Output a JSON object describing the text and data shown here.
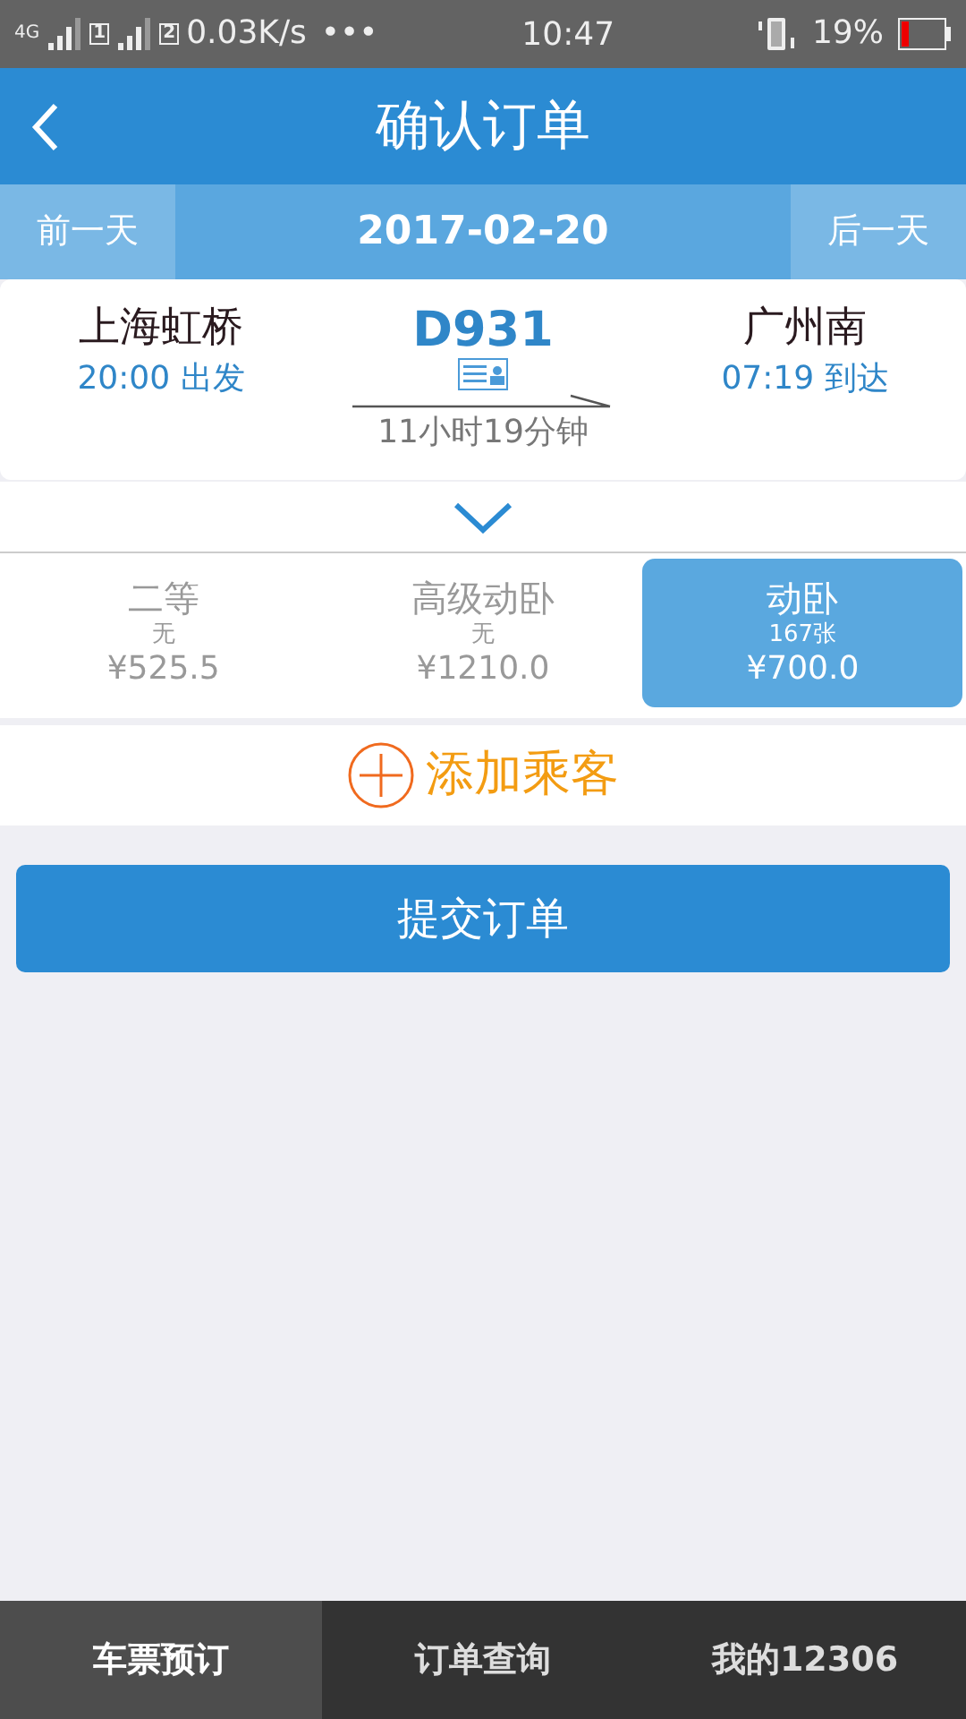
{
  "status_bar": {
    "network": "4G",
    "sim_1": "1",
    "sim_2": "2",
    "speed": "0.03K/s",
    "more": "•••",
    "time": "10:47",
    "battery": "19%"
  },
  "header": {
    "title": "确认订单"
  },
  "date_bar": {
    "prev": "前一天",
    "date": "2017-02-20",
    "next": "后一天"
  },
  "train": {
    "from_station": "上海虹桥",
    "depart": "20:00 出发",
    "number": "D931",
    "duration": "11小时19分钟",
    "to_station": "广州南",
    "arrive": "07:19 到达"
  },
  "seats": [
    {
      "name": "二等",
      "availability": "无",
      "price": "¥525.5",
      "selected": false
    },
    {
      "name": "高级动卧",
      "availability": "无",
      "price": "¥1210.0",
      "selected": false
    },
    {
      "name": "动卧",
      "availability": "167张",
      "price": "¥700.0",
      "selected": true
    }
  ],
  "add_passenger": "添加乘客",
  "submit": "提交订单",
  "tabs": [
    {
      "label": "车票预订",
      "selected": true
    },
    {
      "label": "订单查询",
      "selected": false
    },
    {
      "label": "我的12306",
      "selected": false
    }
  ]
}
